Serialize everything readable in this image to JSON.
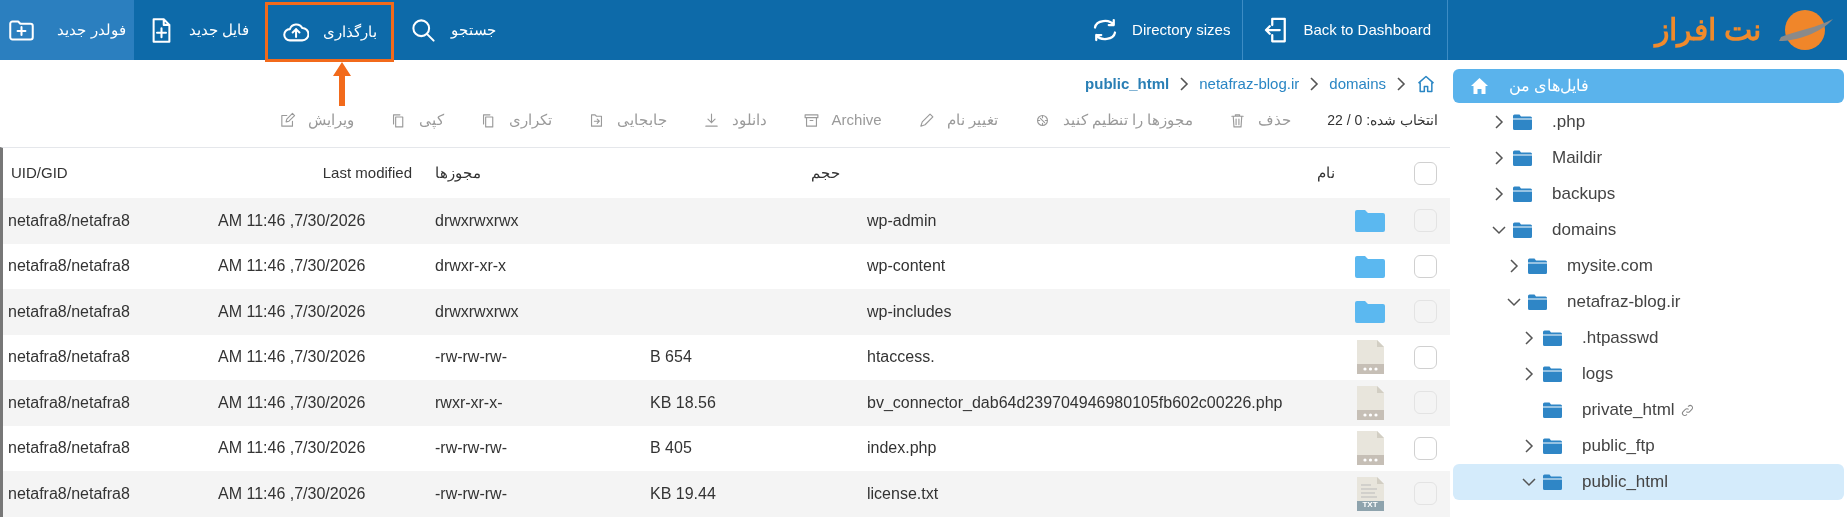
{
  "toolbar": {
    "buttons": [
      {
        "label": "جستجو",
        "active": false,
        "highlighted": false
      },
      {
        "label": "بارگذاری",
        "active": false,
        "highlighted": true
      },
      {
        "label": "فایل جدید",
        "active": false,
        "highlighted": false
      },
      {
        "label": "فولدر جدید",
        "active": true,
        "highlighted": false
      }
    ],
    "right_buttons": [
      {
        "label": "Directory sizes"
      },
      {
        "label": "Back to Dashboard"
      }
    ]
  },
  "annotation": {
    "kind": "arrow"
  },
  "logo": {
    "text": "نت افراز"
  },
  "breadcrumb": [
    {
      "label": "public_html",
      "current": true
    },
    {
      "label": "netafraz-blog.ir",
      "current": false
    },
    {
      "label": "domains",
      "current": false
    }
  ],
  "selection_count": "انتخاب شده: 0 / 22",
  "actions": [
    {
      "label": "حذف",
      "disabled": true
    },
    {
      "label": "مجوزها را تنظیم کنید",
      "disabled": true
    },
    {
      "label": "تغییر نام",
      "disabled": true
    },
    {
      "label": "Archive",
      "disabled": true
    },
    {
      "label": "دانلود",
      "disabled": true
    },
    {
      "label": "جابجایی",
      "disabled": true
    },
    {
      "label": "تکراری",
      "disabled": true
    },
    {
      "label": "کپی",
      "disabled": true
    },
    {
      "label": "ویرایش",
      "disabled": true
    }
  ],
  "table": {
    "all_checked": false,
    "columns": [
      "نام",
      "حجم",
      "مجوزها",
      "Last modified",
      "UID/GID"
    ],
    "rows": [
      {
        "name": "wp-admin",
        "kind": "folder",
        "permissions": "drwxrwxrwx",
        "modified": "AM 11:46 ,7/30/2026",
        "owner": "netafra8/netafra8",
        "checked": false
      },
      {
        "name": "wp-content",
        "kind": "folder",
        "permissions": "drwxr-xr-x",
        "modified": "AM 11:46 ,7/30/2026",
        "owner": "netafra8/netafra8",
        "checked": false
      },
      {
        "name": "wp-includes",
        "kind": "folder",
        "permissions": "drwxrwxrwx",
        "modified": "AM 11:46 ,7/30/2026",
        "owner": "netafra8/netafra8",
        "checked": false
      },
      {
        "name": "htaccess.",
        "kind": "file",
        "size": "B 654",
        "permissions": "-rw-rw-rw-",
        "modified": "AM 11:46 ,7/30/2026",
        "owner": "netafra8/netafra8",
        "checked": false
      },
      {
        "name": "bv_connector_dab64d239704946980105fb602c00226.php",
        "kind": "file",
        "size": "KB 18.56",
        "permissions": "rwxr-xr-x-",
        "modified": "AM 11:46 ,7/30/2026",
        "owner": "netafra8/netafra8",
        "checked": false
      },
      {
        "name": "index.php",
        "kind": "file",
        "size": "B 405",
        "permissions": "-rw-rw-rw-",
        "modified": "AM 11:46 ,7/30/2026",
        "owner": "netafra8/netafra8",
        "checked": false
      },
      {
        "name": "license.txt",
        "kind": "text",
        "badge": "TXT",
        "size": "KB 19.44",
        "permissions": "-rw-rw-rw-",
        "modified": "AM 11:46 ,7/30/2026",
        "owner": "netafra8/netafra8",
        "checked": false
      }
    ]
  },
  "sidebar": {
    "root": {
      "label": "فایل‌های من"
    },
    "items": [
      {
        "name": ".php",
        "kind": "folder",
        "expanded": false,
        "selected": false
      },
      {
        "name": "Maildir",
        "kind": "folder",
        "expanded": false,
        "selected": false
      },
      {
        "name": "backups",
        "kind": "folder",
        "expanded": false,
        "selected": false
      },
      {
        "name": "domains",
        "kind": "folder",
        "expanded": true,
        "selected": false,
        "children": [
          {
            "name": "mysite.com",
            "kind": "folder",
            "expanded": false,
            "selected": false
          },
          {
            "name": "netafraz-blog.ir",
            "kind": "folder",
            "expanded": true,
            "selected": false,
            "children": [
              {
                "name": ".htpasswd",
                "kind": "folder",
                "expanded": false,
                "selected": false
              },
              {
                "name": "logs",
                "kind": "folder",
                "expanded": false,
                "selected": false
              },
              {
                "name": "private_html",
                "kind": "link",
                "selected": false
              },
              {
                "name": "public_ftp",
                "kind": "folder",
                "expanded": false,
                "selected": false
              },
              {
                "name": "public_html",
                "kind": "folder",
                "expanded": true,
                "selected": true
              }
            ]
          }
        ]
      }
    ]
  }
}
